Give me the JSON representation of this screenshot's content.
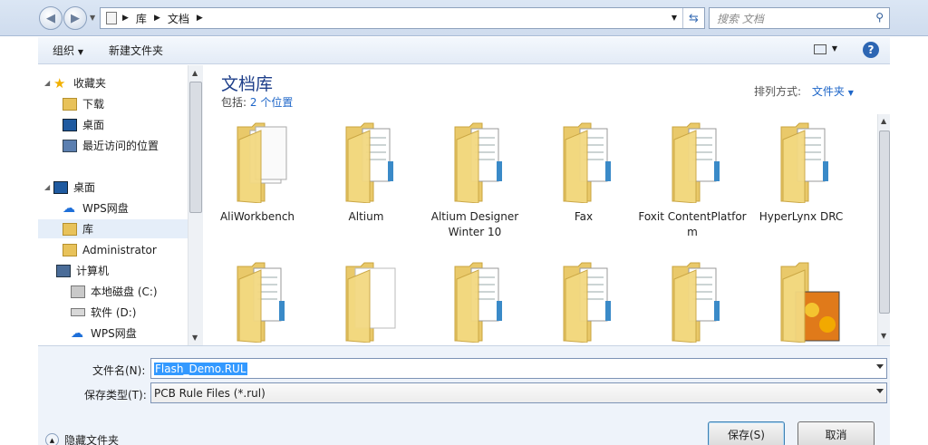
{
  "address": {
    "segments": [
      "库",
      "文档"
    ],
    "search_placeholder": "搜索 文档"
  },
  "toolbar": {
    "organize": "组织",
    "new_folder": "新建文件夹"
  },
  "nav": {
    "favorites": "收藏夹",
    "downloads": "下载",
    "desktop_fav": "桌面",
    "recent": "最近访问的位置",
    "desktop": "桌面",
    "wps1": "WPS网盘",
    "library": "库",
    "admin": "Administrator",
    "computer": "计算机",
    "local_c": "本地磁盘 (C:)",
    "soft_d": "软件 (D:)",
    "wps2": "WPS网盘"
  },
  "header": {
    "title": "文档库",
    "includes_label": "包括:",
    "includes_link": "2 个位置",
    "arrange_label": "排列方式:",
    "arrange_value": "文件夹"
  },
  "folders": [
    {
      "name": "AliWorkbench"
    },
    {
      "name": "Altium"
    },
    {
      "name": "Altium Designer Winter 10"
    },
    {
      "name": "Fax"
    },
    {
      "name": "Foxit ContentPlatfor m"
    },
    {
      "name": "HyperLynx DRC"
    }
  ],
  "filename": {
    "label": "文件名(N):",
    "value": "Flash_Demo.RUL"
  },
  "filetype": {
    "label": "保存类型(T):",
    "value": "PCB Rule Files (*.rul)"
  },
  "footer": {
    "hide_folders": "隐藏文件夹",
    "save": "保存(S)",
    "cancel": "取消"
  }
}
